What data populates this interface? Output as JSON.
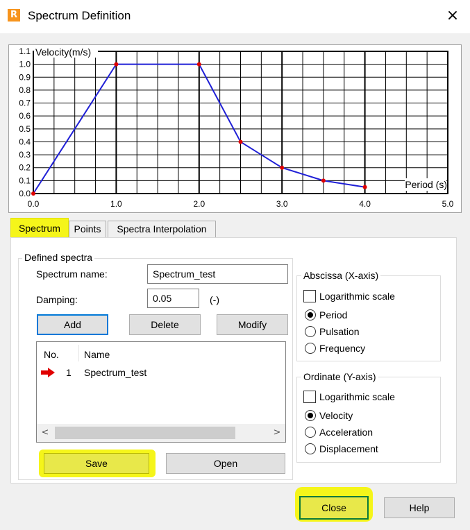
{
  "window": {
    "title": "Spectrum Definition",
    "close_glyph": "×",
    "app_icon_letter": "R"
  },
  "chart_data": {
    "type": "line",
    "xlabel": "Period (s)",
    "ylabel": "Velocity(m/s)",
    "xlim": [
      0,
      5
    ],
    "ylim": [
      0,
      1.1
    ],
    "x_ticks": [
      "0.0",
      "1.0",
      "2.0",
      "3.0",
      "4.0",
      "5.0"
    ],
    "y_ticks": [
      "0.0",
      "0.1",
      "0.2",
      "0.3",
      "0.4",
      "0.5",
      "0.6",
      "0.7",
      "0.8",
      "0.9",
      "1.0",
      "1.1"
    ],
    "grid": true,
    "series": [
      {
        "x": [
          0,
          1,
          2,
          2.5,
          3,
          3.5,
          4
        ],
        "y": [
          0,
          1.0,
          1.0,
          0.4,
          0.2,
          0.1,
          0.05
        ]
      }
    ],
    "line_color": "#1f1fd6",
    "point_color": "#e00000"
  },
  "tabs": [
    {
      "label": "Spectrum",
      "active": true
    },
    {
      "label": "Points",
      "active": false
    },
    {
      "label": "Spectra Interpolation",
      "active": false
    }
  ],
  "defined_spectra": {
    "title": "Defined spectra",
    "name_label": "Spectrum name:",
    "name_value": "Spectrum_test",
    "damping_label": "Damping:",
    "damping_value": "0.05",
    "damping_unit": "(-)",
    "buttons": {
      "add": "Add",
      "delete": "Delete",
      "modify": "Modify"
    },
    "list": {
      "columns": [
        "No.",
        "Name"
      ],
      "rows": [
        {
          "no": "1",
          "name": "Spectrum_test"
        }
      ]
    },
    "scroll_left": "<",
    "scroll_right": ">",
    "save": "Save",
    "open": "Open"
  },
  "abscissa": {
    "title": "Abscissa (X-axis)",
    "log_label": "Logarithmic scale",
    "log_checked": false,
    "options": [
      "Period",
      "Pulsation",
      "Frequency"
    ],
    "selected": "Period"
  },
  "ordinate": {
    "title": "Ordinate (Y-axis)",
    "log_label": "Logarithmic scale",
    "log_checked": false,
    "options": [
      "Velocity",
      "Acceleration",
      "Displacement"
    ],
    "selected": "Velocity"
  },
  "footer": {
    "close": "Close",
    "help": "Help"
  },
  "colors": {
    "highlight": "#f5f51a",
    "focus": "#0078d7",
    "window_bg": "#f0f0f0"
  }
}
